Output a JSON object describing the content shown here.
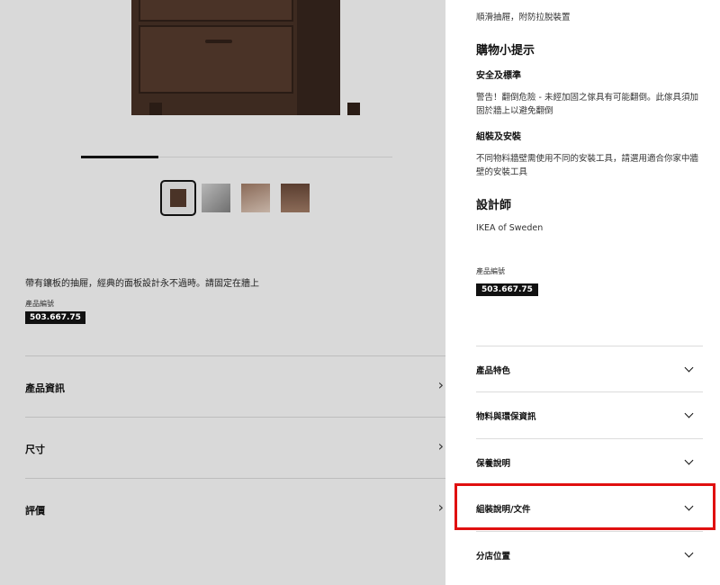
{
  "left": {
    "description": "帶有鑲板的抽屜，經典的面板設計永不過時。請固定在牆上",
    "code_label": "產品編號",
    "code": "503.667.75",
    "accordions": [
      {
        "label": "產品資訊",
        "icon": "chevron-right-icon"
      },
      {
        "label": "尺寸",
        "icon": "chevron-right-icon"
      },
      {
        "label": "評價",
        "icon": "chevron-right-icon"
      }
    ],
    "thumbnail_count": 4,
    "carousel_progress": 0.25
  },
  "right": {
    "feature_text": "順滑抽屜，附防拉脫裝置",
    "tips_heading": "購物小提示",
    "safety_heading": "安全及標準",
    "safety_text": "警告！翻倒危險 - 未經加固之傢具有可能翻倒。此傢具須加固於牆上以避免翻倒",
    "assembly_heading": "組裝及安裝",
    "assembly_text": "不同物料牆壁需使用不同的安裝工具，請選用適合你家中牆壁的安裝工具",
    "designer_heading": "設計師",
    "designer_name": "IKEA of Sweden",
    "code_label": "產品編號",
    "code": "503.667.75",
    "accordions": [
      {
        "label": "產品特色",
        "icon": "chevron-down-icon"
      },
      {
        "label": "物料與環保資訊",
        "icon": "chevron-down-icon"
      },
      {
        "label": "保養說明",
        "icon": "chevron-down-icon"
      },
      {
        "label": "組裝說明/文件",
        "icon": "chevron-down-icon"
      },
      {
        "label": "分店位置",
        "icon": "chevron-down-icon"
      }
    ]
  },
  "colors": {
    "overlay_bg": "#d9d9d9",
    "highlight": "#e01010",
    "badge_bg": "#111111"
  }
}
